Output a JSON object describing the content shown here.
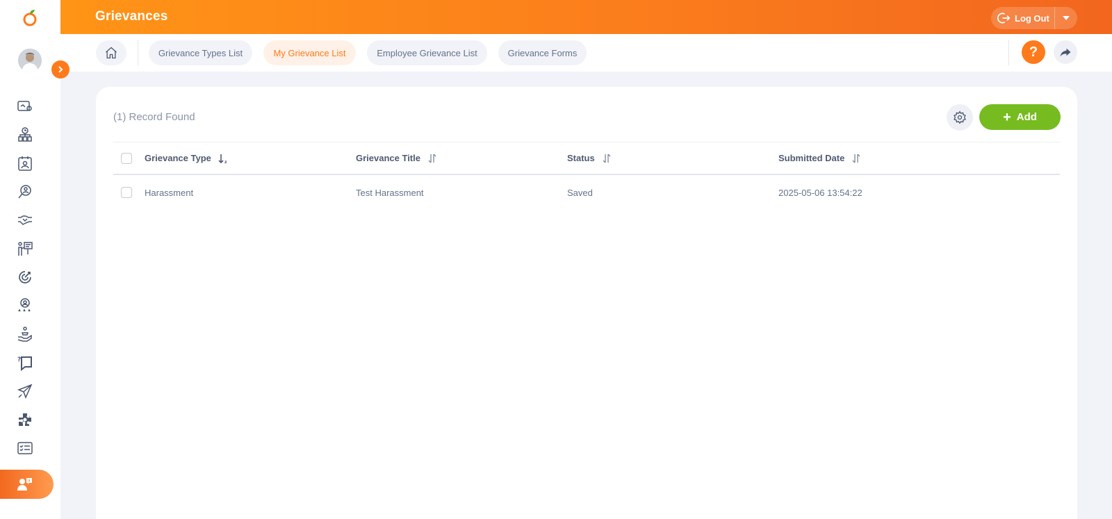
{
  "header": {
    "title": "Grievances",
    "logout_label": "Log Out"
  },
  "nav": {
    "tabs": [
      {
        "label": "Grievance Types List",
        "active": false
      },
      {
        "label": "My Grievance List",
        "active": true
      },
      {
        "label": "Employee Grievance List",
        "active": false
      },
      {
        "label": "Grievance Forms",
        "active": false
      }
    ],
    "help_label": "?"
  },
  "main": {
    "record_count": "(1) Record Found",
    "add_label": "Add"
  },
  "table": {
    "columns": [
      "Grievance Type",
      "Grievance Title",
      "Status",
      "Submitted Date"
    ],
    "rows": [
      [
        "Harassment",
        "Test Harassment",
        "Saved",
        "2025-05-06 13:54:22"
      ]
    ]
  },
  "sidebar": {
    "icons": [
      "dashboard-settings-icon",
      "time-org-icon",
      "leave-calendar-icon",
      "recruitment-search-icon",
      "onboarding-handshake-icon",
      "training-presentation-icon",
      "performance-target-icon",
      "competency-icon",
      "benefits-icon",
      "helpdesk-icon",
      "travel-icon",
      "settings-puzzle-icon",
      "tasks-checklist-icon",
      "grievance-icon"
    ]
  },
  "colors": {
    "accent": "#ff7a1a",
    "add_button": "#76bc21",
    "header_start": "#ff9416",
    "header_end": "#f2661e"
  }
}
